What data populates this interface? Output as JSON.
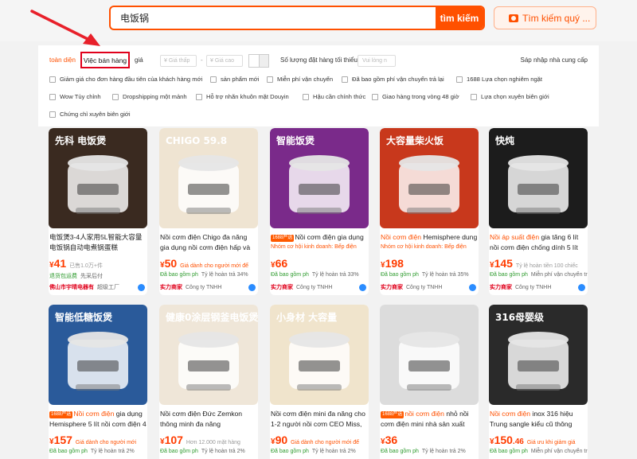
{
  "search": {
    "query": "电饭锅",
    "button_label": "tìm kiếm",
    "image_search_label": "Tìm kiếm quý ..."
  },
  "sort": {
    "comprehensive": "toàn diện",
    "sales": "Việc bán hàng",
    "price": "giá",
    "price_min_placeholder": "Giá thấp",
    "price_max_placeholder": "Giá cao",
    "price_dash": "-",
    "moq_label": "Số lượng đặt hàng tối thiểu",
    "moq_placeholder": "Vui lòng n",
    "merge_suppliers": "Sáp nhập nhà cung cấp"
  },
  "filter_rows": [
    [
      "Giảm giá cho đơn hàng đầu tiên của khách hàng mới",
      "sản phẩm mới",
      "Miễn phí vận chuyển",
      "Đã bao gồm phí vận chuyển trả lại",
      "1688 Lựa chọn nghiêm ngặt"
    ],
    [
      "Wow Tùy chỉnh",
      "Dropshipping một mảnh",
      "Hỗ trợ nhãn khuôn mặt Douyin",
      "Hậu cần chính thức",
      "Giao hàng trong vòng 48 giờ",
      "Lựa chọn xuyên biên giới"
    ],
    [
      "Chứng chỉ xuyên biên giới"
    ]
  ],
  "products": [
    {
      "image_text": "先科 电饭煲",
      "image_color": "#3a2a20",
      "badge": "",
      "title_hl": "",
      "title": "电饭煲3-4人家用5L智能大容量电饭锅自动电煮锅蛋糕",
      "sub": "",
      "price_main": "41",
      "price_dec": "",
      "meta": "已售1.0万+件",
      "meta_red": false,
      "tag1": "退货包运费",
      "tag2": "先采后付",
      "shop": "佛山市宇晴电器有",
      "shop_badge": "超级工厂"
    },
    {
      "image_text": "CHIGO 59.8",
      "image_color": "#efe4d2",
      "badge": "",
      "title_hl": "",
      "title": "Nồi cơm điện Chigo đa năng gia dụng nồi cơm điện hấp và nấu",
      "sub": "",
      "price_main": "50",
      "price_dec": "",
      "meta": "Giá dành cho người mới để",
      "meta_red": true,
      "tag1": "Đã bao gồm ph",
      "tag2": "Tỷ lệ hoàn trả 34%",
      "shop": "实力商家",
      "shop_badge": "Công ty TNHH"
    },
    {
      "image_text": "智能饭煲",
      "image_color": "#7a2a8a",
      "badge": "1688严选",
      "title_hl": "",
      "title": "Nồi cơm điện gia dụng",
      "sub": "Nhóm cơ hội kinh doanh: Bếp điện",
      "price_main": "66",
      "price_dec": "",
      "meta": "",
      "meta_red": false,
      "tag1": "Đã bao gồm ph",
      "tag2": "Tỷ lệ hoàn trả 33%",
      "shop": "实力商家",
      "shop_badge": "Công ty TNHH"
    },
    {
      "image_text": "大容量柴火饭",
      "image_color": "#c8381c",
      "badge": "",
      "title_hl": "Nồi cơm điện",
      "title": " Hemisphere dung",
      "sub": "Nhóm cơ hội kinh doanh: Bếp điện",
      "price_main": "198",
      "price_dec": "",
      "meta": "",
      "meta_red": false,
      "tag1": "Đã bao gồm ph",
      "tag2": "Tỷ lệ hoàn trả 35%",
      "shop": "实力商家",
      "shop_badge": "Công ty TNHH"
    },
    {
      "image_text": "快炖",
      "image_color": "#1c1c1c",
      "badge": "",
      "title_hl": "Nồi áp suất điện",
      "title": " gia tăng 6 lít nồi cơm điện chống dính 5 lít",
      "sub": "",
      "price_main": "145",
      "price_dec": "",
      "meta": "Tỷ lệ hoàn tiền 100 chiếc",
      "meta_red": false,
      "tag1": "Đã bao gồm ph",
      "tag2": "Miễn phí vận chuyển trả lại",
      "shop": "实力商家",
      "shop_badge": "Công ty TNHH"
    },
    {
      "image_text": "智能低糖饭煲",
      "image_color": "#2a5a9a",
      "badge": "1688严选",
      "title_hl": "Nồi cơm điện",
      "title": " gia dụng Hemisphere 5 lít nồi cơm điện 4",
      "sub": "",
      "price_main": "157",
      "price_dec": "",
      "meta": "Giá dành cho người mới",
      "meta_red": true,
      "tag1": "Đã bao gồm ph",
      "tag2": "Tỷ lệ hoàn trả 2%",
      "shop": "",
      "shop_badge": ""
    },
    {
      "image_text": "健康0涂层钢釜电饭煲",
      "image_color": "#efe6d8",
      "badge": "",
      "title_hl": "",
      "title": "Nồi cơm điện Đức Zemkon thông minh đa năng",
      "sub": "",
      "price_main": "107",
      "price_dec": "",
      "meta": "Hơn 12.000 mặt hàng",
      "meta_red": false,
      "tag1": "Đã bao gồm ph",
      "tag2": "Tỷ lệ hoàn trả 2%",
      "shop": "",
      "shop_badge": ""
    },
    {
      "image_text": "小身材 大容量",
      "image_color": "#f0e4cc",
      "badge": "",
      "title_hl": "",
      "title": "Nồi cơm điện mini đa năng cho 1-2 người nồi cơm CEO Miss, đồ",
      "sub": "",
      "price_main": "90",
      "price_dec": "",
      "meta": "Giá dành cho người mới để",
      "meta_red": true,
      "tag1": "Đã bao gồm ph",
      "tag2": "Tỷ lệ hoàn trả 2%",
      "shop": "",
      "shop_badge": ""
    },
    {
      "image_text": "",
      "image_color": "#dcdcdc",
      "badge": "1688严选",
      "title_hl": "nồi cơm điện",
      "title": " nhỏ nồi cơm điện mini nhà sản xuất",
      "sub": "",
      "price_main": "36",
      "price_dec": "",
      "meta": "",
      "meta_red": false,
      "tag1": "Đã bao gồm ph",
      "tag2": "Tỷ lệ hoàn trả 2%",
      "shop": "",
      "shop_badge": ""
    },
    {
      "image_text": "316母婴级",
      "image_color": "#2a2a2a",
      "badge": "",
      "title_hl": "Nồi cơm điện",
      "title": " inox 316 hiệu Trung sangle kiểu cũ thông minh",
      "sub": "",
      "price_main": "150",
      "price_dec": ".46",
      "meta": "Giá ưu khi giảm giá",
      "meta_red": true,
      "tag1": "Đã bao gồm ph",
      "tag2": "Miễn phí vận chuyển trả lại",
      "shop": "",
      "shop_badge": ""
    }
  ]
}
